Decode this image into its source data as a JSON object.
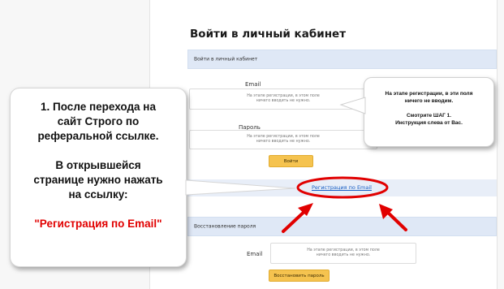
{
  "page": {
    "title": "Войти в личный кабинет"
  },
  "login_panel": {
    "header": "Войти в личный кабинет",
    "email_label": "Email",
    "email_placeholder": "На этапе регистрации, в этом поле ничего вводить не нужно.",
    "password_label": "Пароль",
    "password_placeholder": "На этапе регистрации, в этом поле ничего вводить не нужно.",
    "submit_label": "Войти"
  },
  "register_link": "Регистрация по Email",
  "recovery_panel": {
    "header": "Восстановление пароля",
    "email_label": "Email",
    "email_placeholder": "На этапе регистрации, в этом поле ничего вводить не нужно.",
    "submit_label": "Восстановить пароль"
  },
  "callout_left": {
    "lines": [
      "1. После перехода на",
      "сайт Строго по",
      "реферальной ссылке.",
      "",
      "В открывшейся",
      "странице нужно нажать",
      "на ссылку:",
      "",
      "\"Регистрация по Email\""
    ]
  },
  "callout_right": {
    "lines": [
      "На этапе регистрации, в эти поля",
      "ничего не вводим.",
      "",
      "Смотрите ШАГ 1.",
      "Инструкция слева от Вас."
    ]
  },
  "colors": {
    "accent_button": "#f5c34f",
    "link": "#1a5fc4",
    "annotation": "#e10000",
    "panel_header": "#dfe8f6"
  },
  "icons": {
    "arrows": "red-arrow-icon",
    "highlight": "red-ellipse-highlight"
  }
}
